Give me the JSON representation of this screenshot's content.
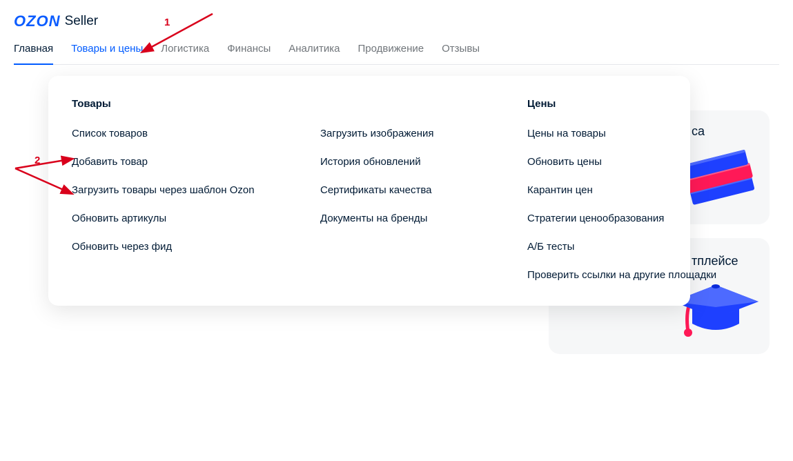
{
  "logo": {
    "brand": "OZON",
    "suffix": "Seller"
  },
  "nav": {
    "items": [
      {
        "label": "Главная",
        "current": true
      },
      {
        "label": "Товары и цены",
        "active": true
      },
      {
        "label": "Логистика"
      },
      {
        "label": "Финансы"
      },
      {
        "label": "Аналитика"
      },
      {
        "label": "Продвижение"
      },
      {
        "label": "Отзывы"
      }
    ]
  },
  "dropdown": {
    "groups": [
      {
        "heading": "Товары",
        "items": [
          "Список товаров",
          "Добавить товар",
          "Загрузить товары через шаблон Ozon",
          "Обновить артикулы",
          "Обновить через фид"
        ]
      },
      {
        "heading": "",
        "items": [
          "Загрузить изображения",
          "История обновлений",
          "Сертификаты качества",
          "Документы на бренды"
        ]
      },
      {
        "heading": "Цены",
        "items": [
          "Цены на товары",
          "Обновить цены",
          "Карантин цен",
          "Стратегии ценообразования",
          "А/Б тесты",
          "Проверить ссылки на другие площадки"
        ]
      }
    ]
  },
  "annotations": {
    "one": "1",
    "two": "2"
  },
  "bg_cards": {
    "card1_fragment": "са",
    "card2_fragment": "тплейсе"
  }
}
